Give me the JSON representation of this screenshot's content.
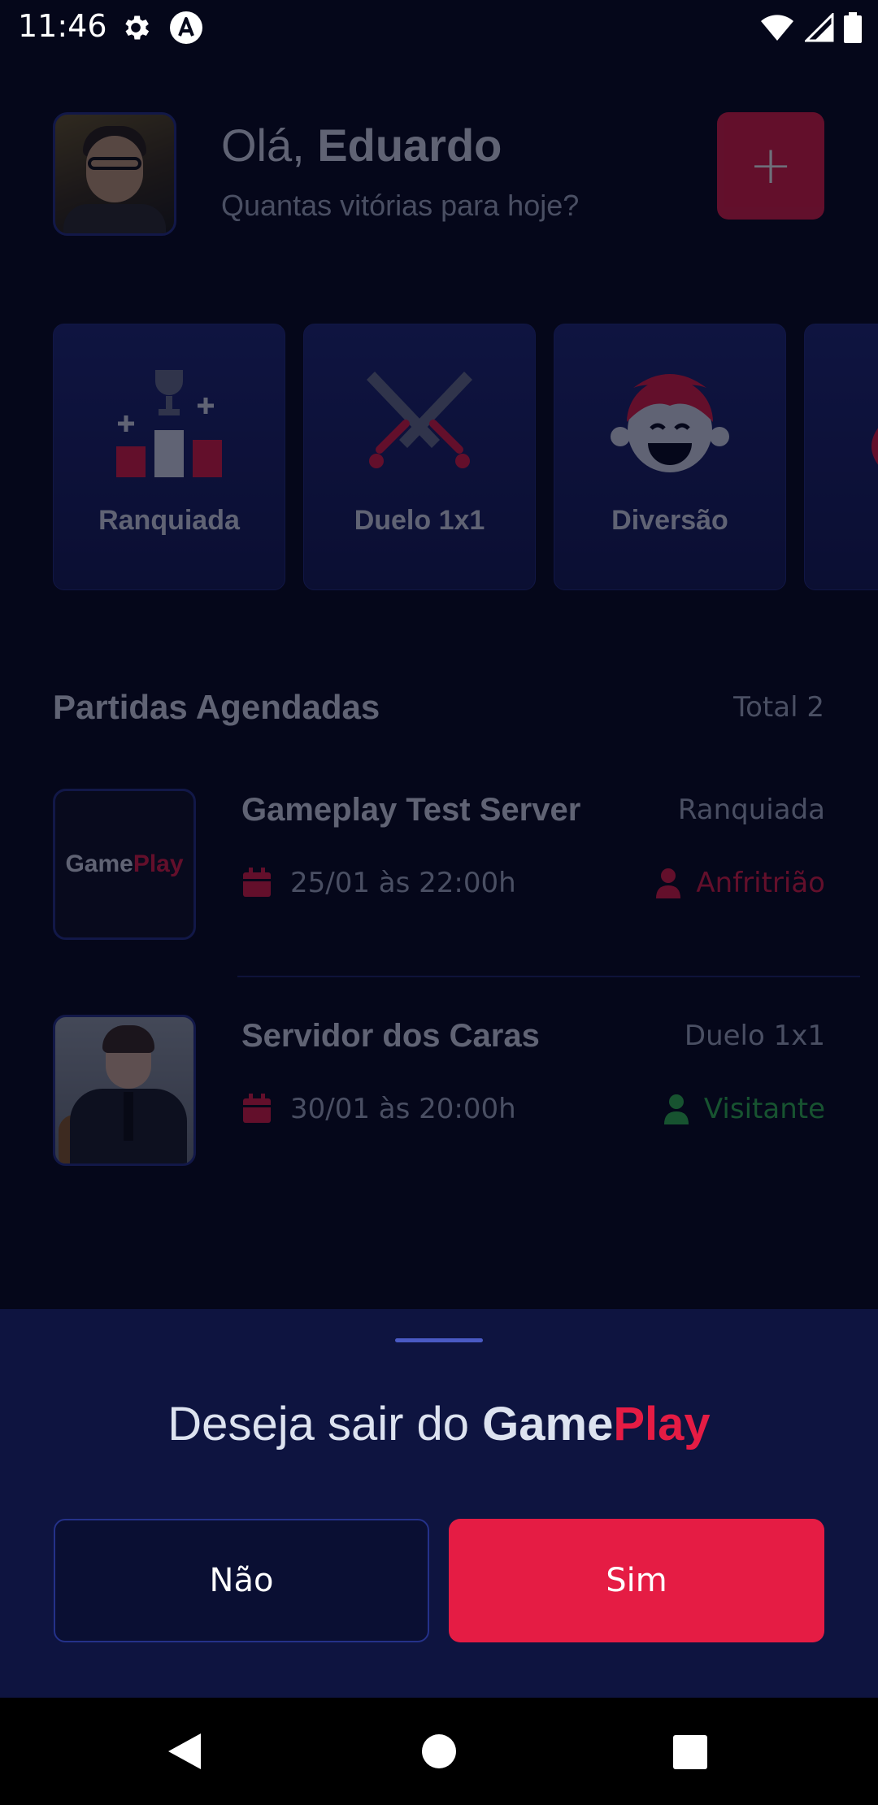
{
  "status_bar": {
    "time": "11:46",
    "icons": [
      "gear-icon",
      "react-icon",
      "wifi-icon",
      "signal-icon",
      "battery-icon"
    ]
  },
  "header": {
    "greeting_prefix": "Olá,",
    "user_name": "Eduardo",
    "subtitle": "Quantas vitórias para hoje?",
    "add_label": "+"
  },
  "categories": [
    {
      "label": "Ranquiada",
      "icon": "ranked-podium-icon"
    },
    {
      "label": "Duelo 1x1",
      "icon": "crossed-swords-icon"
    },
    {
      "label": "Diversão",
      "icon": "laughing-face-icon"
    }
  ],
  "scheduled": {
    "title": "Partidas Agendadas",
    "total": "Total 2",
    "matches": [
      {
        "title": "Gameplay Test Server",
        "category": "Ranquiada",
        "date": "25/01 às 22:00h",
        "role": "Anfritrião",
        "role_color": "#e51c44",
        "thumb_game": "Game",
        "thumb_play": "Play"
      },
      {
        "title": "Servidor dos Caras",
        "category": "Duelo 1x1",
        "date": "30/01 às 20:00h",
        "role": "Visitante",
        "role_color": "#32bd50"
      }
    ]
  },
  "sheet": {
    "prefix": "Deseja sair do",
    "brand_game": "Game",
    "brand_play": "Play",
    "no_label": "Não",
    "yes_label": "Sim"
  },
  "colors": {
    "accent": "#e51c44",
    "background": "#05071a",
    "sheet": "#0e1440",
    "border": "#243189"
  }
}
